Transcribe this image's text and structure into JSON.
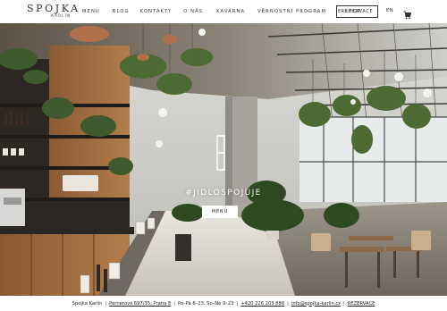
{
  "header": {
    "logo": {
      "word": "SPOJKA",
      "sub": "KARLÍN"
    },
    "nav": [
      {
        "label": "MENU"
      },
      {
        "label": "BLOG"
      },
      {
        "label": "KONTAKTY"
      },
      {
        "label": "O NÁS"
      },
      {
        "label": "KAVÁRNA"
      },
      {
        "label": "VĚRNOSTNÍ PROGRAM"
      },
      {
        "label": "E-SHOP"
      }
    ],
    "reservation": "REZERVACE",
    "language": "EN",
    "cart_icon": "cart-icon"
  },
  "hero": {
    "hashtag": "#JIDLOSPOJUJE",
    "menu_button": "MENU"
  },
  "footer": {
    "name": "Spojka Karlín",
    "address": "Pernerova 697/35, Praha 8",
    "hours": "Po–Pá 8–23, So–Ne 9–23",
    "phone": "+420 226 203 888",
    "email": "info@spojka-karlin.cz",
    "reservation": "REZERVACE"
  },
  "colors": {
    "text": "#333333",
    "background": "#ffffff",
    "accent": "#ffffff"
  }
}
